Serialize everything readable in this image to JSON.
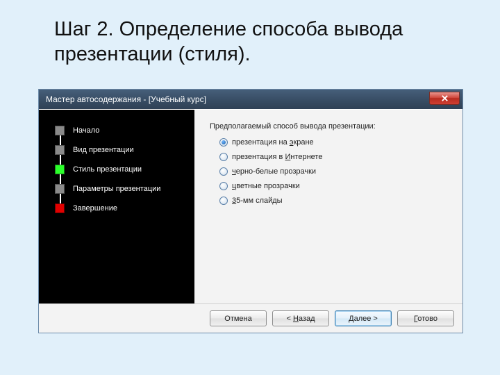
{
  "slide": {
    "title": "Шаг 2. Определение способа вывода презентации (стиля)."
  },
  "window": {
    "title": "Мастер автосодержания - [Учебный курс]",
    "steps": [
      {
        "label": "Начало",
        "color": "gray"
      },
      {
        "label": "Вид презентации",
        "color": "gray"
      },
      {
        "label": "Стиль презентации",
        "color": "green"
      },
      {
        "label": "Параметры презентации",
        "color": "gray"
      },
      {
        "label": "Завершение",
        "color": "red"
      }
    ],
    "prompt": "Предполагаемый способ вывода презентации:",
    "options": [
      {
        "pre": "презентация на ",
        "u": "э",
        "post": "кране",
        "checked": true
      },
      {
        "pre": "презентация в ",
        "u": "И",
        "post": "нтернете",
        "checked": false
      },
      {
        "pre": "",
        "u": "ч",
        "post": "ерно-белые прозрачки",
        "checked": false
      },
      {
        "pre": "",
        "u": "ц",
        "post": "ветные прозрачки",
        "checked": false
      },
      {
        "pre": "",
        "u": "3",
        "post": "5-мм слайды",
        "checked": false
      }
    ],
    "buttons": {
      "cancel": "Отмена",
      "back_pre": "< ",
      "back_u": "Н",
      "back_post": "азад",
      "next_pre": "",
      "next_u": "Д",
      "next_post": "алее >",
      "finish_pre": "",
      "finish_u": "Г",
      "finish_post": "отово"
    }
  }
}
